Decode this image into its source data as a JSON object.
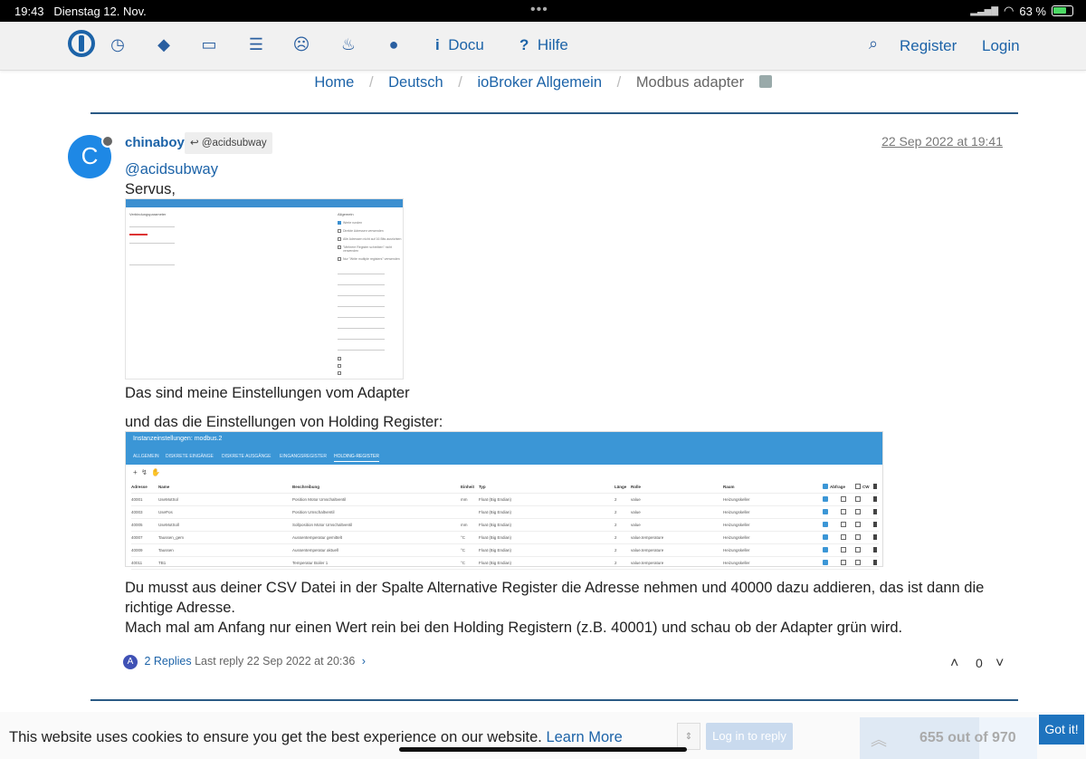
{
  "status_bar": {
    "time": "19:43",
    "date": "Dienstag 12. Nov.",
    "battery": "63 %"
  },
  "navbar": {
    "docu": "Docu",
    "hilfe": "Hilfe",
    "register": "Register",
    "login": "Login",
    "icons": [
      "clock-icon",
      "tags-icon",
      "inbox-icon",
      "list-icon",
      "frown-icon",
      "fire-icon",
      "github-icon",
      "info-icon",
      "question-icon",
      "search-icon"
    ]
  },
  "breadcrumb": {
    "items": [
      "Home",
      "Deutsch",
      "ioBroker Allgemein"
    ],
    "current": "Modbus adapter",
    "separator": "/"
  },
  "post": {
    "avatar_letter": "C",
    "author": "chinaboy",
    "reply_to": "@acidsubway",
    "date": "22 Sep 2022 at 19:41",
    "mention": "@acidsubway",
    "greeting": "Servus,",
    "line_settings": "Das sind meine Einstellungen vom Adapter",
    "line_holding": "und das die Einstellungen von Holding Register:",
    "paragraph_1": "Du musst aus deiner CSV Datei in der Spalte Alternative Register die Adresse nehmen und 40000 dazu addieren, das ist dann die",
    "paragraph_1b": "richtige Adresse.",
    "paragraph_2": "Mach mal am Anfang nur einen Wert rein bei den Holding Registern (z.B. 40001) und schau ob der Adapter grün wird.",
    "replies_avatar": "A",
    "replies_count": "2 Replies",
    "last_reply": "Last reply 22 Sep 2022 at 20:36",
    "votes": "0"
  },
  "screenshot1": {
    "left_title": "Verbindungsparameter",
    "right_title": "Allgemein",
    "option_1": "Werte runden",
    "option_2": "Direkte Adressen verwenden",
    "option_3": "Alle Adressen nicht auf 16 Bits ausrichten",
    "option_4": "\"Mehrere Register schreiben\" nicht verwenden",
    "option_5": "Nur \"Write multiple registers\" verwenden"
  },
  "screenshot2": {
    "title": "Instanzeinstellungen: modbus.2",
    "tabs": [
      "ALLGEMEIN",
      "DISKRETE EINGÄNGE",
      "DISKRETE AUSGÄNGE",
      "EINGANGSREGISTER",
      "HOLDING-REGISTER"
    ],
    "columns": [
      "Adresse",
      "Name",
      "Beschreibung",
      "Einheit",
      "Typ",
      "Länge",
      "Rolle",
      "Raum",
      "Abfrage",
      "CW"
    ],
    "rows": [
      [
        "40001",
        "UseMotSol",
        "Position Motor Umschaltventil",
        "mm",
        "Float (Big Endian)",
        "2",
        "value",
        "Heizungskeller"
      ],
      [
        "40003",
        "UsePos",
        "Position Umschaltventil",
        "",
        "Float (Big Endian)",
        "2",
        "value",
        "Heizungskeller"
      ],
      [
        "40005",
        "UseMotSoll",
        "Sollposition Motor Umschaltventil",
        "mm",
        "Float (Big Endian)",
        "2",
        "value",
        "Heizungskeller"
      ],
      [
        "40007",
        "Taussen_gem",
        "Aussentemperatur gemittelt",
        "°C",
        "Float (Big Endian)",
        "2",
        "value.temperature",
        "Heizungskeller"
      ],
      [
        "40009",
        "Taussen",
        "Aussentemperatur aktuell",
        "°C",
        "Float (Big Endian)",
        "2",
        "value.temperature",
        "Heizungskeller"
      ],
      [
        "40011",
        "TB1",
        "Temperatur Boiler 1",
        "°C",
        "Float (Big Endian)",
        "2",
        "value.temperature",
        "Heizungskeller"
      ]
    ]
  },
  "footer": {
    "cookie_text": "This website uses cookies to ensure you get the best experience on our website.",
    "learn_more": "Learn More",
    "got_it": "Got it!",
    "log_in_to_reply": "Log in to reply",
    "progress": "655 out of 970",
    "progress_fraction": 0.675
  }
}
